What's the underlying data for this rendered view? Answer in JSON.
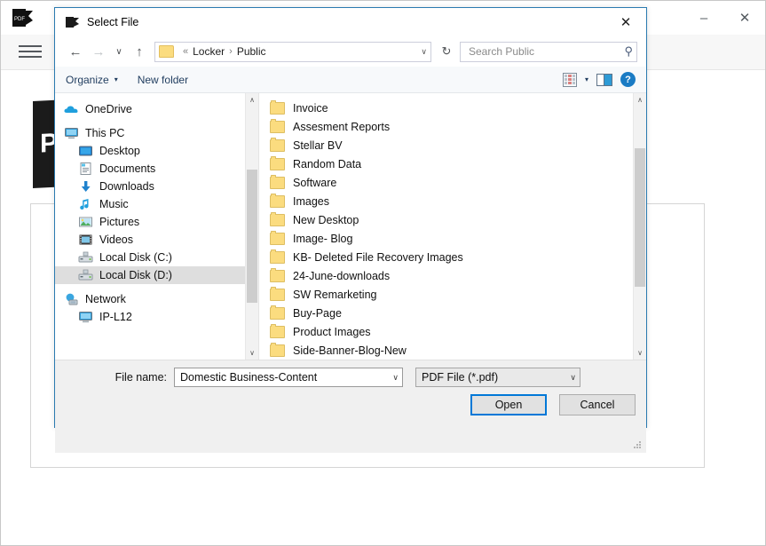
{
  "background_app": {
    "app_icon": "pdf-icon",
    "logo_text": "PD",
    "menu_icon": "hamburger-menu-icon",
    "minimize_label": "–",
    "close_label": "✕"
  },
  "dialog": {
    "title": "Select File",
    "title_icon": "select-file-icon",
    "close_label": "✕",
    "nav": {
      "back_label": "←",
      "forward_label": "→",
      "recent_label": "∨",
      "up_label": "↑",
      "refresh_label": "↻",
      "address_caret": "∨",
      "breadcrumb_prefix": "«",
      "breadcrumb": [
        "Locker",
        "Public"
      ],
      "breadcrumb_separator": "›"
    },
    "search": {
      "placeholder": "Search Public",
      "value": "",
      "icon": "search-icon"
    },
    "command_bar": {
      "organize_label": "Organize",
      "organize_caret": "▾",
      "new_folder_label": "New folder",
      "view_caret": "▾",
      "help_label": "?"
    },
    "tree": [
      {
        "label": "OneDrive",
        "icon": "cloud-icon",
        "level": 0,
        "selected": false,
        "spacer_after": true
      },
      {
        "label": "This PC",
        "icon": "computer-icon",
        "level": 0,
        "selected": false,
        "spacer_after": false
      },
      {
        "label": "Desktop",
        "icon": "desktop-icon",
        "level": 1,
        "selected": false,
        "spacer_after": false
      },
      {
        "label": "Documents",
        "icon": "documents-icon",
        "level": 1,
        "selected": false,
        "spacer_after": false
      },
      {
        "label": "Downloads",
        "icon": "downloads-icon",
        "level": 1,
        "selected": false,
        "spacer_after": false
      },
      {
        "label": "Music",
        "icon": "music-icon",
        "level": 1,
        "selected": false,
        "spacer_after": false
      },
      {
        "label": "Pictures",
        "icon": "pictures-icon",
        "level": 1,
        "selected": false,
        "spacer_after": false
      },
      {
        "label": "Videos",
        "icon": "videos-icon",
        "level": 1,
        "selected": false,
        "spacer_after": false
      },
      {
        "label": "Local Disk (C:)",
        "icon": "disk-icon",
        "level": 1,
        "selected": false,
        "spacer_after": false
      },
      {
        "label": "Local Disk (D:)",
        "icon": "disk-icon",
        "level": 1,
        "selected": true,
        "spacer_after": true
      },
      {
        "label": "Network",
        "icon": "network-icon",
        "level": 0,
        "selected": false,
        "spacer_after": false
      },
      {
        "label": "IP-L12",
        "icon": "computer-icon",
        "level": 1,
        "selected": false,
        "spacer_after": false
      }
    ],
    "files": [
      {
        "name": "Invoice",
        "icon": "folder-icon"
      },
      {
        "name": "Assesment Reports",
        "icon": "folder-icon"
      },
      {
        "name": "Stellar BV",
        "icon": "folder-icon"
      },
      {
        "name": "Random Data",
        "icon": "folder-icon"
      },
      {
        "name": "Software",
        "icon": "folder-icon"
      },
      {
        "name": "Images",
        "icon": "folder-icon"
      },
      {
        "name": "New Desktop",
        "icon": "folder-icon"
      },
      {
        "name": "Image- Blog",
        "icon": "folder-icon"
      },
      {
        "name": "KB- Deleted File Recovery Images",
        "icon": "folder-icon"
      },
      {
        "name": "24-June-downloads",
        "icon": "folder-icon"
      },
      {
        "name": "SW Remarketing",
        "icon": "folder-icon"
      },
      {
        "name": "Buy-Page",
        "icon": "folder-icon"
      },
      {
        "name": "Product Images",
        "icon": "folder-icon"
      },
      {
        "name": "Side-Banner-Blog-New",
        "icon": "folder-icon"
      }
    ],
    "form": {
      "file_name_label": "File name:",
      "file_name_value": "Domestic Business-Content",
      "file_name_caret": "∨",
      "filter_value": "PDF File (*.pdf)",
      "filter_caret": "∨",
      "open_label": "Open",
      "cancel_label": "Cancel"
    },
    "scrollbars": {
      "up_arrow": "∧",
      "down_arrow": "∨"
    },
    "accent_color": "#0078d7",
    "selection_color": "#dedede"
  }
}
